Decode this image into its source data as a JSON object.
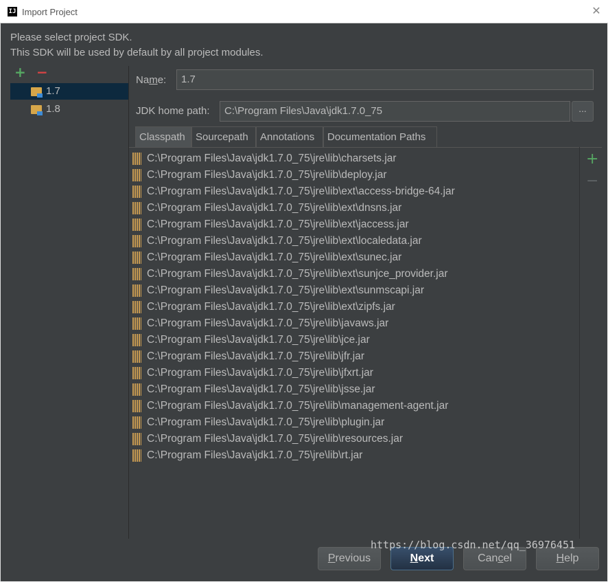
{
  "window": {
    "title": "Import Project",
    "app_icon_text": "IJ",
    "close_glyph": "✕"
  },
  "intro": {
    "line1": "Please select project SDK.",
    "line2": "This SDK will be used by default by all project modules."
  },
  "sdk_toolbar": {
    "add_glyph": "+",
    "remove_glyph": "−"
  },
  "sdk_list": [
    {
      "label": "1.7",
      "selected": true
    },
    {
      "label": "1.8",
      "selected": false
    }
  ],
  "form": {
    "name_label_pre": "Na",
    "name_label_mn": "m",
    "name_label_post": "e:",
    "name_value": "1.7",
    "jdk_label": "JDK home path:",
    "jdk_value": "C:\\Program Files\\Java\\jdk1.7.0_75",
    "browse_label": "..."
  },
  "tabs": [
    {
      "label": "Classpath",
      "active": true
    },
    {
      "label": "Sourcepath",
      "active": false
    },
    {
      "label": "Annotations",
      "active": false
    },
    {
      "label": "Documentation Paths",
      "active": false
    }
  ],
  "classpath": [
    "C:\\Program Files\\Java\\jdk1.7.0_75\\jre\\lib\\charsets.jar",
    "C:\\Program Files\\Java\\jdk1.7.0_75\\jre\\lib\\deploy.jar",
    "C:\\Program Files\\Java\\jdk1.7.0_75\\jre\\lib\\ext\\access-bridge-64.jar",
    "C:\\Program Files\\Java\\jdk1.7.0_75\\jre\\lib\\ext\\dnsns.jar",
    "C:\\Program Files\\Java\\jdk1.7.0_75\\jre\\lib\\ext\\jaccess.jar",
    "C:\\Program Files\\Java\\jdk1.7.0_75\\jre\\lib\\ext\\localedata.jar",
    "C:\\Program Files\\Java\\jdk1.7.0_75\\jre\\lib\\ext\\sunec.jar",
    "C:\\Program Files\\Java\\jdk1.7.0_75\\jre\\lib\\ext\\sunjce_provider.jar",
    "C:\\Program Files\\Java\\jdk1.7.0_75\\jre\\lib\\ext\\sunmscapi.jar",
    "C:\\Program Files\\Java\\jdk1.7.0_75\\jre\\lib\\ext\\zipfs.jar",
    "C:\\Program Files\\Java\\jdk1.7.0_75\\jre\\lib\\javaws.jar",
    "C:\\Program Files\\Java\\jdk1.7.0_75\\jre\\lib\\jce.jar",
    "C:\\Program Files\\Java\\jdk1.7.0_75\\jre\\lib\\jfr.jar",
    "C:\\Program Files\\Java\\jdk1.7.0_75\\jre\\lib\\jfxrt.jar",
    "C:\\Program Files\\Java\\jdk1.7.0_75\\jre\\lib\\jsse.jar",
    "C:\\Program Files\\Java\\jdk1.7.0_75\\jre\\lib\\management-agent.jar",
    "C:\\Program Files\\Java\\jdk1.7.0_75\\jre\\lib\\plugin.jar",
    "C:\\Program Files\\Java\\jdk1.7.0_75\\jre\\lib\\resources.jar",
    "C:\\Program Files\\Java\\jdk1.7.0_75\\jre\\lib\\rt.jar"
  ],
  "side_tools": {
    "add_glyph": "+",
    "remove_glyph": "−"
  },
  "footer": {
    "previous_mn": "P",
    "previous_rest": "revious",
    "next_mn": "N",
    "next_rest": "ext",
    "cancel_pre": "Can",
    "cancel_mn": "c",
    "cancel_post": "el",
    "help_mn": "H",
    "help_rest": "elp"
  },
  "watermark": "https://blog.csdn.net/qq_36976451",
  "colors": {
    "dialog_bg": "#3c3f41",
    "selection_bg": "#0d293e",
    "add_green": "#56a863",
    "remove_red": "#d74444",
    "primary_button": "#2b3f57"
  }
}
